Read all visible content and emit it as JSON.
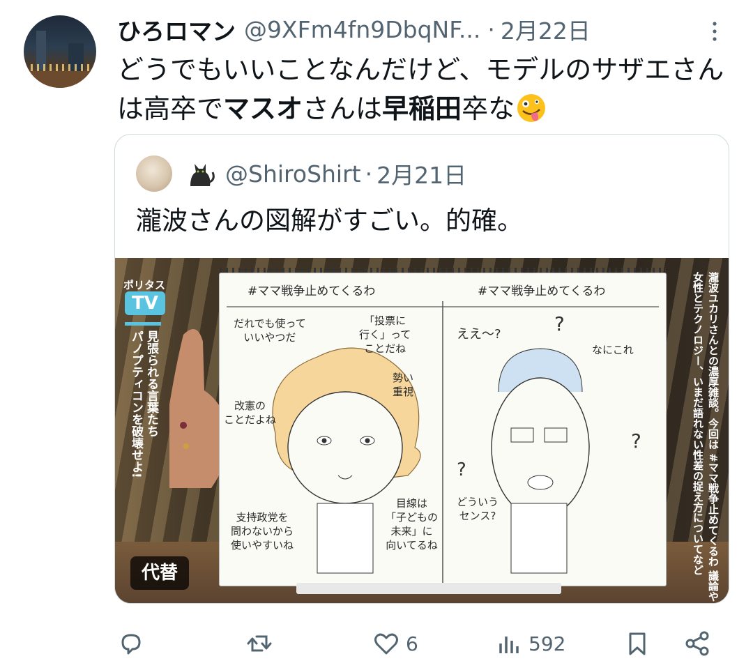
{
  "author": {
    "name": "ひろロマン",
    "handle": "@9XFm4fn9DbqNF...",
    "separator": "·",
    "date": "2月22日"
  },
  "tweet": {
    "text_part1": "どうでもいいことなんだけど、モデルのサザエさんは高卒で",
    "bold1": "マスオ",
    "text_part2": "さんは",
    "bold2": "早稲田",
    "text_part3": "卒な",
    "emoji": "zany-face-icon"
  },
  "quote": {
    "handle": "@ShiroShirt",
    "separator": "·",
    "date": "2月21日",
    "text": "瀧波さんの図解がすごい。的確。",
    "image": {
      "tv_logo_top": "ポリタス",
      "tv_logo": "TV",
      "left_caption_1": "見張られる言葉たち",
      "left_caption_2": "パノプティコンを破壊せよ!",
      "right_caption_1": "瀧波ユカリさんとの濃厚雑談。今回は #ママ戦争止めてくるわ 議論や",
      "right_caption_2": "女性とテクノロジー、いまだ語れない性差の捉え方についてなど",
      "left_header": "#ママ戦争止めてくるわ",
      "right_header": "#ママ戦争止めてくるわ",
      "bubble_l1": "だれでも使って\nいいやつだ",
      "bubble_l2": "「投票に\n行く」って\nことだね",
      "bubble_l3": "勢い\n重視",
      "bubble_l4": "改憲の\nことだよね",
      "bubble_l5": "支持政党を\n問わないから\n使いやすいね",
      "bubble_l6": "目線は\n「子どもの\n未来」に\n向いてるね",
      "bubble_r1": "ええ〜?",
      "bubble_r2": "なにこれ",
      "bubble_r3": "どういう\nセンス?",
      "alt_badge": "代替"
    }
  },
  "actions": {
    "reply_icon": "reply-icon",
    "retweet_icon": "retweet-icon",
    "like_icon": "heart-icon",
    "like_count": "6",
    "views_icon": "views-icon",
    "view_count": "592",
    "bookmark_icon": "bookmark-icon",
    "share_icon": "share-icon"
  },
  "colors": {
    "text": "#0f1419",
    "secondary": "#536471",
    "border": "#cfd9de",
    "tv_accent": "#59c3e0"
  }
}
